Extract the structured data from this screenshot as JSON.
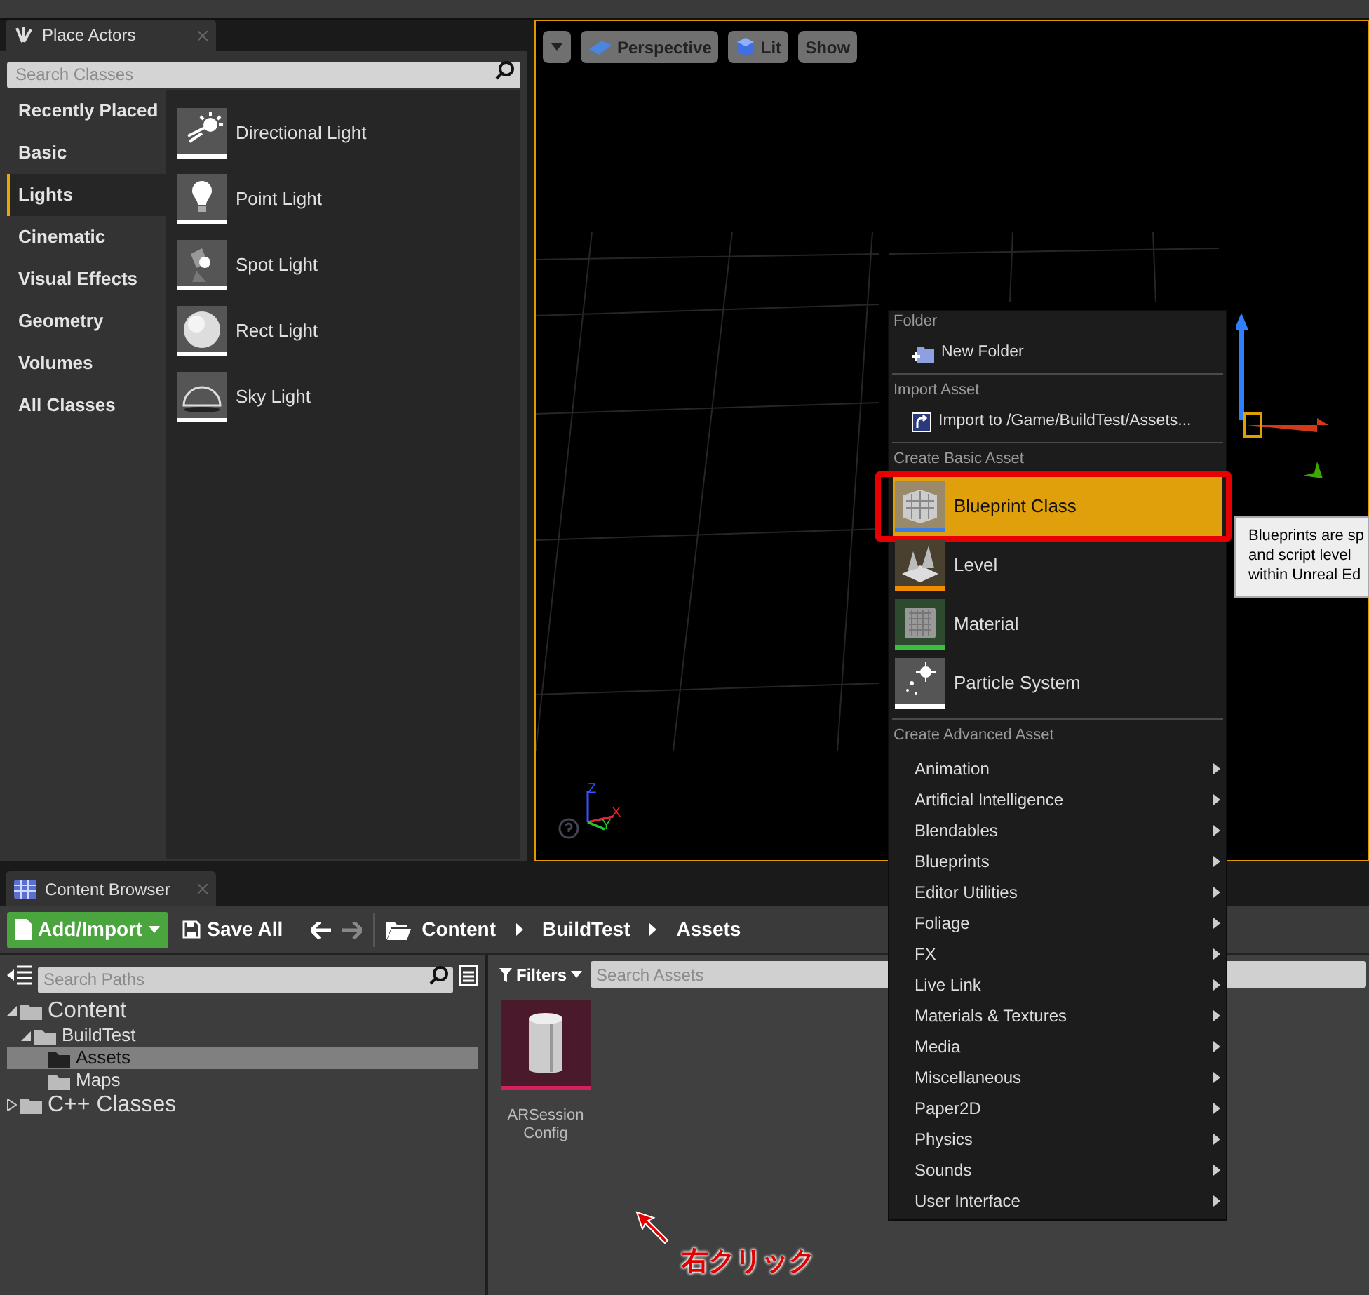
{
  "place_actors": {
    "tab": "Place Actors",
    "search_placeholder": "Search Classes",
    "categories": [
      {
        "label": "Recently Placed",
        "selected": false
      },
      {
        "label": "Basic",
        "selected": false
      },
      {
        "label": "Lights",
        "selected": true
      },
      {
        "label": "Cinematic",
        "selected": false
      },
      {
        "label": "Visual Effects",
        "selected": false
      },
      {
        "label": "Geometry",
        "selected": false
      },
      {
        "label": "Volumes",
        "selected": false
      },
      {
        "label": "All Classes",
        "selected": false
      }
    ],
    "items": [
      {
        "label": "Directional Light"
      },
      {
        "label": "Point Light"
      },
      {
        "label": "Spot Light"
      },
      {
        "label": "Rect Light"
      },
      {
        "label": "Sky Light"
      }
    ]
  },
  "viewport": {
    "buttons": [
      {
        "label": "Perspective"
      },
      {
        "label": "Lit"
      },
      {
        "label": "Show"
      }
    ],
    "axis_labels": [
      "Z",
      "X",
      "Y"
    ]
  },
  "content_browser": {
    "tab": "Content Browser",
    "add_import": "Add/Import",
    "save_all": "Save All",
    "breadcrumbs": [
      "Content",
      "BuildTest",
      "Assets"
    ],
    "search_paths_placeholder": "Search Paths",
    "filters": "Filters",
    "search_assets_placeholder": "Search Assets",
    "tree": [
      {
        "label": "Content",
        "expanded": true,
        "selected": false,
        "children": [
          {
            "label": "BuildTest",
            "expanded": true,
            "selected": false,
            "children": [
              {
                "label": "Assets",
                "selected": true
              },
              {
                "label": "Maps",
                "selected": false
              }
            ]
          }
        ]
      },
      {
        "label": "C++ Classes",
        "expanded": false,
        "selected": false
      }
    ],
    "assets": [
      {
        "label": "ARSession Config"
      }
    ]
  },
  "context_menu": {
    "sections": [
      {
        "heading": "Folder",
        "items": [
          {
            "kind": "action",
            "label": "New Folder"
          }
        ]
      },
      {
        "heading": "Import Asset",
        "items": [
          {
            "kind": "action",
            "label": "Import to /Game/BuildTest/Assets..."
          }
        ]
      },
      {
        "heading": "Create Basic Asset",
        "items": [
          {
            "kind": "asset",
            "label": "Blueprint Class",
            "selected": true,
            "framed": true,
            "color": "#3c7ee0"
          },
          {
            "kind": "asset",
            "label": "Level",
            "selected": false,
            "framed": false,
            "color": "#f08c00"
          },
          {
            "kind": "asset",
            "label": "Material",
            "selected": false,
            "framed": false,
            "color": "#3cc040"
          },
          {
            "kind": "asset",
            "label": "Particle System",
            "selected": false,
            "framed": false,
            "color": "#ffffff"
          }
        ]
      },
      {
        "heading": "Create Advanced Asset",
        "items": [
          {
            "kind": "submenu",
            "label": "Animation"
          },
          {
            "kind": "submenu",
            "label": "Artificial Intelligence"
          },
          {
            "kind": "submenu",
            "label": "Blendables"
          },
          {
            "kind": "submenu",
            "label": "Blueprints"
          },
          {
            "kind": "submenu",
            "label": "Editor Utilities"
          },
          {
            "kind": "submenu",
            "label": "Foliage"
          },
          {
            "kind": "submenu",
            "label": "FX"
          },
          {
            "kind": "submenu",
            "label": "Live Link"
          },
          {
            "kind": "submenu",
            "label": "Materials & Textures"
          },
          {
            "kind": "submenu",
            "label": "Media"
          },
          {
            "kind": "submenu",
            "label": "Miscellaneous"
          },
          {
            "kind": "submenu",
            "label": "Paper2D"
          },
          {
            "kind": "submenu",
            "label": "Physics"
          },
          {
            "kind": "submenu",
            "label": "Sounds"
          },
          {
            "kind": "submenu",
            "label": "User Interface"
          }
        ]
      }
    ]
  },
  "tooltip": {
    "lines": [
      "Blueprints are sp",
      "and script level",
      "within Unreal Ed"
    ]
  },
  "annotation": {
    "text": "右クリック"
  }
}
